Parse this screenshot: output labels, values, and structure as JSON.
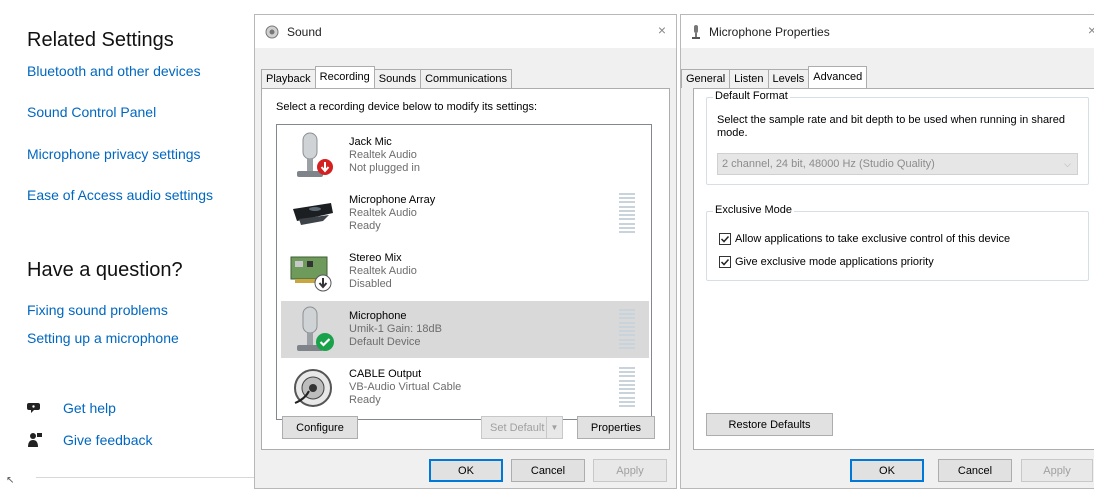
{
  "settings": {
    "related_heading": "Related Settings",
    "links": [
      "Bluetooth and other devices",
      "Sound Control Panel",
      "Microphone privacy settings",
      "Ease of Access audio settings"
    ],
    "question_heading": "Have a question?",
    "help_links": [
      "Fixing sound problems",
      "Setting up a microphone"
    ],
    "get_help": "Get help",
    "give_feedback": "Give feedback"
  },
  "sound_dialog": {
    "title": "Sound",
    "close": "×",
    "tabs": [
      "Playback",
      "Recording",
      "Sounds",
      "Communications"
    ],
    "active_tab": "Recording",
    "instruction": "Select a recording device below to modify its settings:",
    "devices": [
      {
        "name": "Jack Mic",
        "line1": "Realtek Audio",
        "line2": "Not plugged in",
        "status": "unplugged",
        "meter": false,
        "selected": false
      },
      {
        "name": "Microphone Array",
        "line1": "Realtek Audio",
        "line2": "Ready",
        "status": "ready",
        "meter": true,
        "selected": false
      },
      {
        "name": "Stereo Mix",
        "line1": "Realtek Audio",
        "line2": "Disabled",
        "status": "disabled",
        "meter": false,
        "selected": false
      },
      {
        "name": "Microphone",
        "line1": "Umik-1  Gain: 18dB",
        "line2": "Default Device",
        "status": "default",
        "meter": true,
        "selected": true
      },
      {
        "name": "CABLE Output",
        "line1": "VB-Audio Virtual Cable",
        "line2": "Ready",
        "status": "ready",
        "meter": true,
        "selected": false
      }
    ],
    "configure": "Configure",
    "set_default": "Set Default",
    "properties": "Properties",
    "ok": "OK",
    "cancel": "Cancel",
    "apply": "Apply"
  },
  "mic_dialog": {
    "title": "Microphone Properties",
    "close": "×",
    "tabs": [
      "General",
      "Listen",
      "Levels",
      "Advanced"
    ],
    "active_tab": "Advanced",
    "default_format": {
      "title": "Default Format",
      "description": "Select the sample rate and bit depth to be used when running in shared mode.",
      "selected": "2 channel, 24 bit, 48000 Hz (Studio Quality)"
    },
    "exclusive_mode": {
      "title": "Exclusive Mode",
      "allow_exclusive": "Allow applications to take exclusive control of this device",
      "priority": "Give exclusive mode applications priority",
      "allow_checked": true,
      "priority_checked": true
    },
    "restore_defaults": "Restore Defaults",
    "ok": "OK",
    "cancel": "Cancel",
    "apply": "Apply"
  },
  "colors": {
    "link": "#0067c0",
    "dialog_bg": "#f0f0f0",
    "selected_row": "#d9d9d9",
    "default_check": "#1aa14b",
    "unplugged_badge": "#d42020"
  }
}
